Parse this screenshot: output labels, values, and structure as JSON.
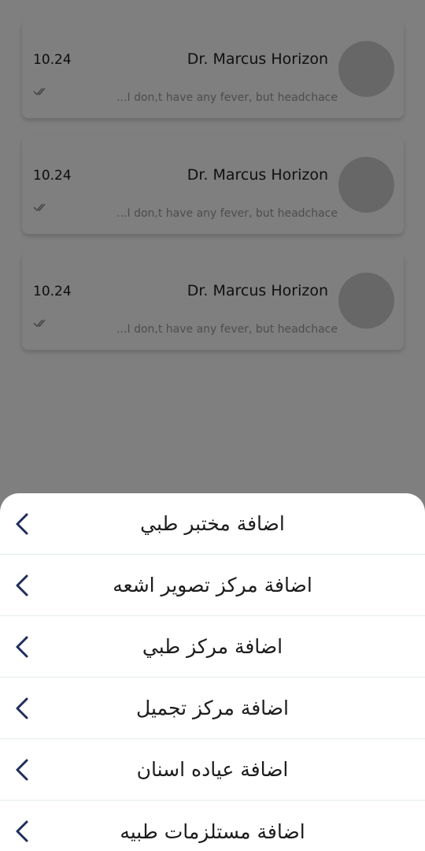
{
  "chats": [
    {
      "time": "10.24",
      "name": "Dr. Marcus Horizon",
      "preview": "...I don,t have any fever, but headchace"
    },
    {
      "time": "10.24",
      "name": "Dr. Marcus Horizon",
      "preview": "...I don,t have any fever, but headchace"
    },
    {
      "time": "10.24",
      "name": "Dr. Marcus Horizon",
      "preview": "...I don,t have any fever, but headchace"
    }
  ],
  "menu": {
    "items": [
      {
        "label": "اضافة مختبر طبي",
        "icon": "chevron-left-icon"
      },
      {
        "label": "اضافة مركز تصوير اشعه",
        "icon": "chevron-left-icon"
      },
      {
        "label": "اضافة مركز طبي",
        "icon": "chevron-left-icon"
      },
      {
        "label": "اضافة مركز تجميل",
        "icon": "chevron-left-icon"
      },
      {
        "label": "اضافة عياده اسنان",
        "icon": "chevron-left-icon"
      },
      {
        "label": "اضافة مستلزمات طبيه",
        "icon": "chevron-left-icon"
      }
    ]
  },
  "colors": {
    "overlay": "#000000",
    "chevron": "#1e2d5a",
    "divider": "#e4ecec"
  }
}
